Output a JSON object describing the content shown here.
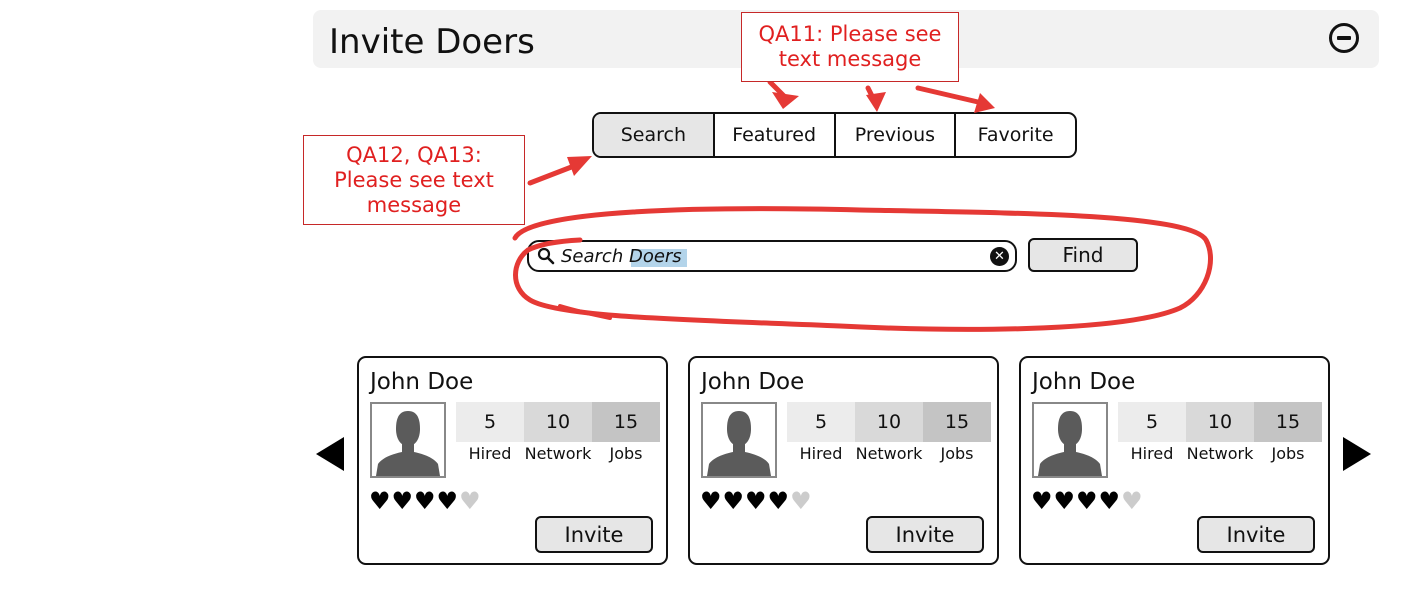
{
  "header": {
    "title": "Invite Doers",
    "collapse_icon": "minus-circle-icon"
  },
  "tabs": [
    {
      "label": "Search",
      "active": true
    },
    {
      "label": "Featured",
      "active": false
    },
    {
      "label": "Previous",
      "active": false
    },
    {
      "label": "Favorite",
      "active": false
    }
  ],
  "annotations": {
    "note_1": "QA11: Please see text message",
    "note_2": "QA12, QA13: Please see text message",
    "color": "#e53935"
  },
  "search": {
    "prefix": "Search ",
    "highlighted": "Doers",
    "value": "Search Doers",
    "find_label": "Find",
    "search_icon": "search-icon",
    "clear_icon": "clear-icon"
  },
  "carousel": {
    "prev_icon": "arrow-left-icon",
    "next_icon": "arrow-right-icon"
  },
  "stat_labels": [
    "Hired",
    "Network",
    "Jobs"
  ],
  "cards": [
    {
      "name": "John Doe",
      "hired": "5",
      "network": "10",
      "jobs": "15",
      "rating": 4,
      "rating_max": 5,
      "invite_label": "Invite"
    },
    {
      "name": "John Doe",
      "hired": "5",
      "network": "10",
      "jobs": "15",
      "rating": 4,
      "rating_max": 5,
      "invite_label": "Invite"
    },
    {
      "name": "John Doe",
      "hired": "5",
      "network": "10",
      "jobs": "15",
      "rating": 4,
      "rating_max": 5,
      "invite_label": "Invite"
    }
  ]
}
